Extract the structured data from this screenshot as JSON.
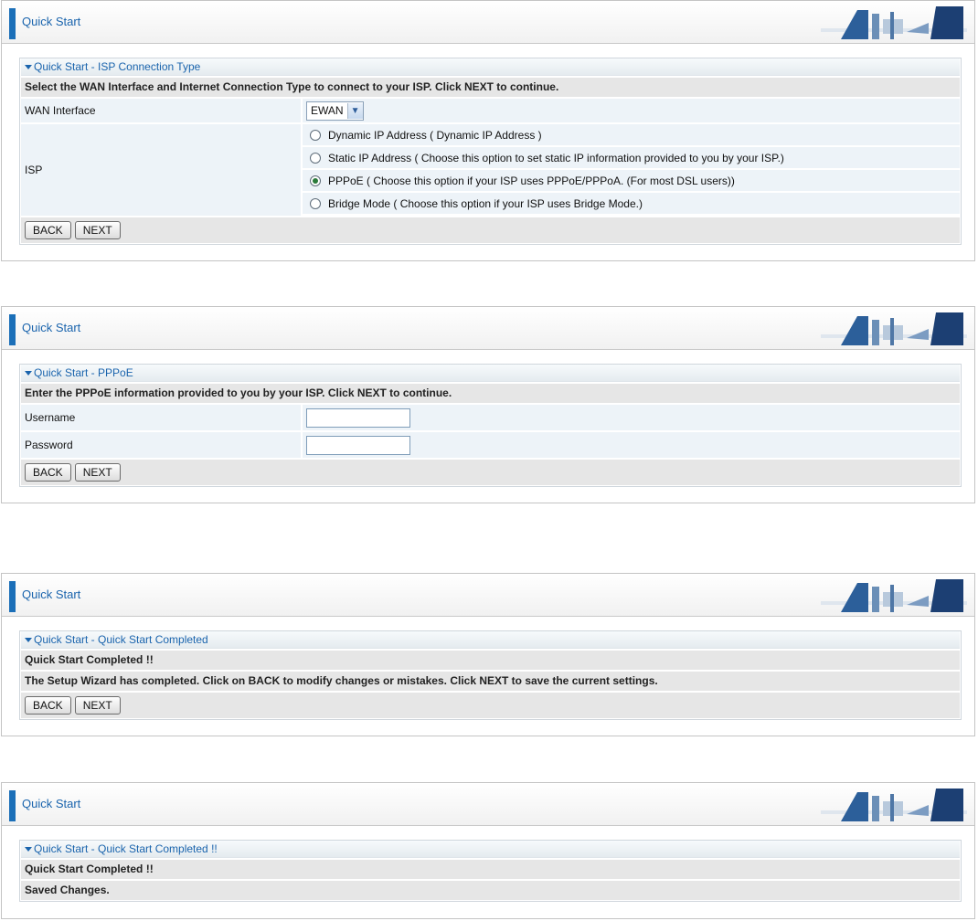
{
  "panels": [
    {
      "header_title": "Quick Start",
      "box_title": "Quick Start - ISP Connection Type",
      "instruction": "Select the WAN Interface and Internet Connection Type to connect to your ISP. Click NEXT to continue.",
      "wan_label": "WAN Interface",
      "wan_value": "EWAN",
      "isp_label": "ISP",
      "isp_options": [
        {
          "label": "Dynamic IP Address ( Dynamic IP Address )",
          "selected": false
        },
        {
          "label": "Static IP Address ( Choose this option to set static IP information provided to you by your ISP.)",
          "selected": false
        },
        {
          "label": "PPPoE ( Choose this option if your ISP uses PPPoE/PPPoA. (For most DSL users))",
          "selected": true
        },
        {
          "label": "Bridge Mode ( Choose this option if your ISP uses Bridge Mode.)",
          "selected": false
        }
      ],
      "back_label": "BACK",
      "next_label": "NEXT"
    },
    {
      "header_title": "Quick Start",
      "box_title": "Quick Start - PPPoE",
      "instruction": "Enter the PPPoE information provided to you by your ISP. Click NEXT to continue.",
      "username_label": "Username",
      "password_label": "Password",
      "back_label": "BACK",
      "next_label": "NEXT"
    },
    {
      "header_title": "Quick Start",
      "box_title": "Quick Start - Quick Start Completed",
      "line1": "Quick Start Completed !!",
      "line2": "The Setup Wizard has completed. Click on BACK to modify changes or mistakes. Click NEXT to save the current settings.",
      "back_label": "BACK",
      "next_label": "NEXT"
    },
    {
      "header_title": "Quick Start",
      "box_title": "Quick Start - Quick Start Completed !!",
      "line1": "Quick Start Completed !!",
      "line2": "Saved Changes."
    }
  ],
  "colors": {
    "accent": "#1a64ad",
    "header_bar": "#1b6fb8",
    "row_blue": "#edf3f8",
    "row_grey": "#e6e6e6"
  },
  "icons": {
    "header_logo": "network-graphic-icon",
    "collapse": "triangle-down-icon"
  }
}
